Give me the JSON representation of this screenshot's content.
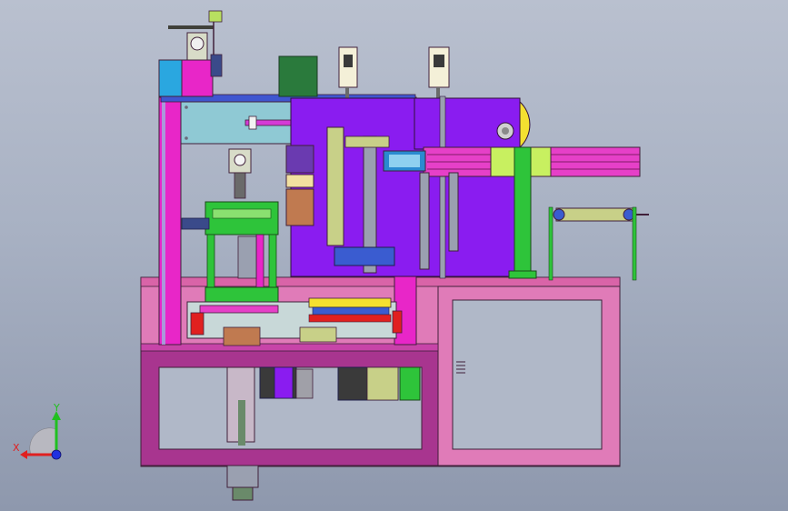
{
  "view": {
    "background_top": "#b9c0cf",
    "background_bottom": "#8e98ad"
  },
  "triad": {
    "x_label": "X",
    "y_label": "Y",
    "x_color": "#e02020",
    "y_color": "#20c020",
    "z_color": "#2030e0",
    "origin_color": "#6a6a6a"
  },
  "parts": {
    "frame_pink": "#e07bb8",
    "frame_magenta": "#a8358f",
    "column_magenta": "#e826c8",
    "plate_cyan": "#8fc9d4",
    "block_purple": "#8a1cf0",
    "cylinder_pink": "#e640c8",
    "green_parts": "#2ec43a",
    "lime_parts": "#c8f060",
    "dark_green_box": "#2a7a3c",
    "blue_block": "#3a5cd0",
    "yellow_disk": "#f4e030"
  }
}
